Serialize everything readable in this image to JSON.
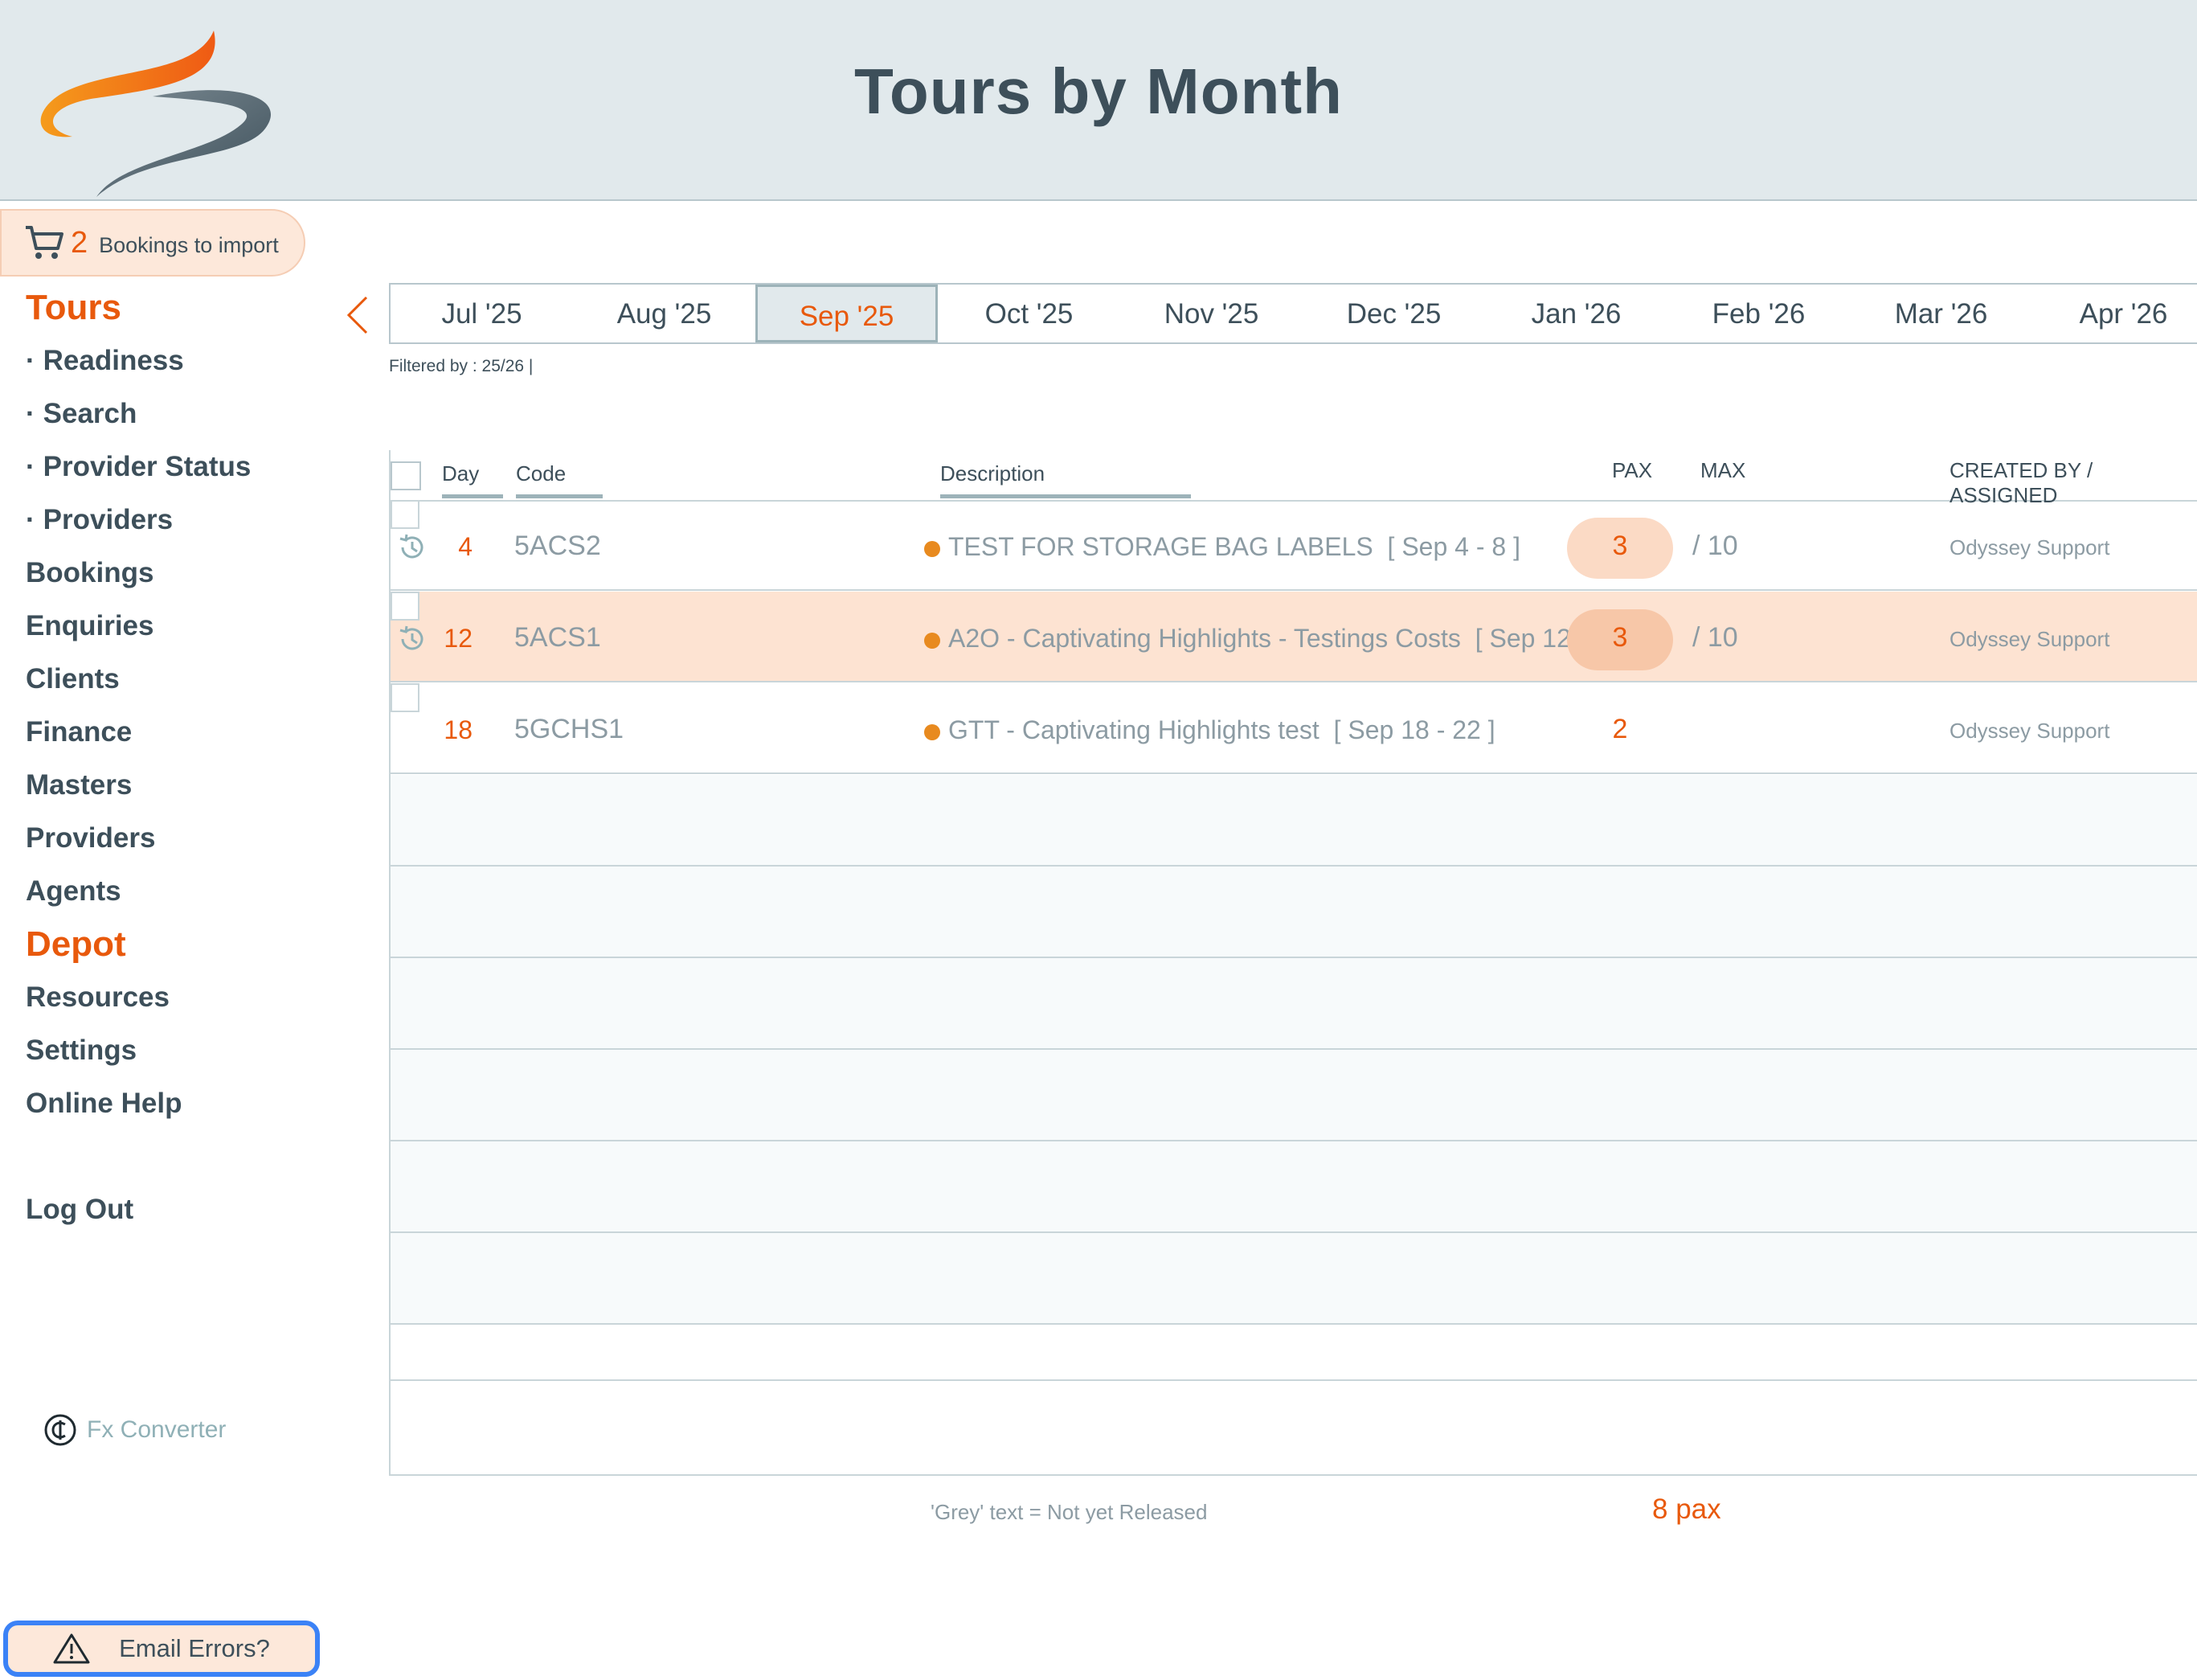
{
  "header": {
    "title": "Tours by Month"
  },
  "imports": {
    "count": "2",
    "label": "Bookings to import"
  },
  "nav": [
    {
      "label": "Tours",
      "kind": "section",
      "key": "tours"
    },
    {
      "label": "Readiness",
      "kind": "sub",
      "key": "readiness"
    },
    {
      "label": "Search",
      "kind": "sub",
      "key": "search"
    },
    {
      "label": "Provider Status",
      "kind": "sub",
      "key": "provider-status"
    },
    {
      "label": "Providers",
      "kind": "sub",
      "key": "providers-sub"
    },
    {
      "label": "Bookings",
      "kind": "item",
      "key": "bookings"
    },
    {
      "label": "Enquiries",
      "kind": "item",
      "key": "enquiries"
    },
    {
      "label": "Clients",
      "kind": "item",
      "key": "clients"
    },
    {
      "label": "Finance",
      "kind": "item",
      "key": "finance"
    },
    {
      "label": "Masters",
      "kind": "item",
      "key": "masters"
    },
    {
      "label": "Providers",
      "kind": "item",
      "key": "providers"
    },
    {
      "label": "Agents",
      "kind": "item",
      "key": "agents"
    },
    {
      "label": "Depot",
      "kind": "section",
      "key": "depot"
    },
    {
      "label": "Resources",
      "kind": "item",
      "key": "resources"
    },
    {
      "label": "Settings",
      "kind": "item",
      "key": "settings"
    },
    {
      "label": "Online Help",
      "kind": "item",
      "key": "online-help"
    },
    {
      "label": "",
      "kind": "gap",
      "key": "gap"
    },
    {
      "label": "Log Out",
      "kind": "item",
      "key": "log-out"
    }
  ],
  "fx": {
    "label": "Fx Converter"
  },
  "email": {
    "label": "Email Errors?"
  },
  "months": [
    {
      "label": "Jul '25",
      "active": false
    },
    {
      "label": "Aug '25",
      "active": false
    },
    {
      "label": "Sep '25",
      "active": true
    },
    {
      "label": "Oct '25",
      "active": false
    },
    {
      "label": "Nov '25",
      "active": false
    },
    {
      "label": "Dec '25",
      "active": false
    },
    {
      "label": "Jan '26",
      "active": false
    },
    {
      "label": "Feb '26",
      "active": false
    },
    {
      "label": "Mar '26",
      "active": false
    },
    {
      "label": "Apr '26",
      "active": false
    }
  ],
  "filter": {
    "text": "Filtered by : 25/26 |"
  },
  "table": {
    "headers": {
      "day": "Day",
      "code": "Code",
      "description": "Description",
      "pax": "PAX",
      "max": "MAX",
      "created": "CREATED BY / ASSIGNED"
    },
    "rows": [
      {
        "day": "4",
        "code": "5ACS2",
        "description": "TEST FOR STORAGE BAG LABELS",
        "dates": "[ Sep 4 - 8 ]",
        "pax": "3",
        "max": "/ 10",
        "created_by": "Odyssey Support",
        "history": true,
        "highlight": false,
        "pax_pill": true
      },
      {
        "day": "12",
        "code": "5ACS1",
        "description": "A2O - Captivating Highlights - Testings Costs",
        "dates": "[ Sep 12 - 16 ]",
        "pax": "3",
        "max": "/ 10",
        "created_by": "Odyssey Support",
        "history": true,
        "highlight": true,
        "pax_pill": true
      },
      {
        "day": "18",
        "code": "5GCHS1",
        "description": "GTT - Captivating Highlights test",
        "dates": "[ Sep 18 - 22 ]",
        "pax": "2",
        "max": "",
        "created_by": "Odyssey Support",
        "history": false,
        "highlight": false,
        "pax_pill": false
      }
    ],
    "empty_rows": 7
  },
  "footer": {
    "note": "'Grey' text = Not yet Released",
    "total": "8 pax"
  },
  "colors": {
    "accent": "#e8590c",
    "header_bg": "#e1e9ec",
    "highlight_row": "#fde3d2",
    "text": "#3d4f5a",
    "muted": "#8c9ba3",
    "focus_ring": "#3b82f6"
  }
}
